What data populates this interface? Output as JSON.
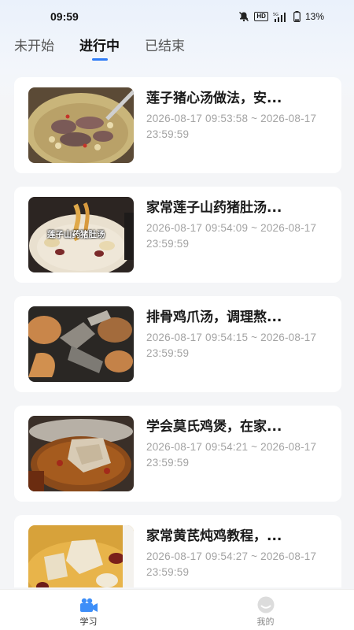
{
  "status_bar": {
    "time": "09:59",
    "icons": [
      "mute-icon",
      "hd-icon",
      "5g-signal-icon",
      "battery-icon"
    ],
    "hd_label": "HD",
    "battery": "13%"
  },
  "tabs": [
    {
      "label": "未开始",
      "active": false
    },
    {
      "label": "进行中",
      "active": true
    },
    {
      "label": "已结束",
      "active": false
    }
  ],
  "accent_color": "#2f7cf6",
  "courses": [
    {
      "title": "莲子猪心汤做法，安...",
      "time": "2026-08-17 09:53:58 ~ 2026-08-17 23:59:59",
      "thumb_icon": "soup-image",
      "thumb_caption": ""
    },
    {
      "title": "家常莲子山药猪肚汤...",
      "time": "2026-08-17 09:54:09 ~ 2026-08-17 23:59:59",
      "thumb_icon": "soup-image",
      "thumb_caption": "莲子山药猪肚汤"
    },
    {
      "title": "排骨鸡爪汤，调理熬...",
      "time": "2026-08-17 09:54:15 ~ 2026-08-17 23:59:59",
      "thumb_icon": "chicken-feet-image",
      "thumb_caption": ""
    },
    {
      "title": "学会莫氏鸡煲，在家...",
      "time": "2026-08-17 09:54:21 ~ 2026-08-17 23:59:59",
      "thumb_icon": "chicken-pot-image",
      "thumb_caption": ""
    },
    {
      "title": "家常黄芪炖鸡教程，...",
      "time": "2026-08-17 09:54:27 ~ 2026-08-17 23:59:59",
      "thumb_icon": "stewed-chicken-image",
      "thumb_caption": ""
    }
  ],
  "bottom_nav": [
    {
      "label": "学习",
      "icon": "video-camera-icon",
      "active": true
    },
    {
      "label": "我的",
      "icon": "profile-icon",
      "active": false
    }
  ]
}
